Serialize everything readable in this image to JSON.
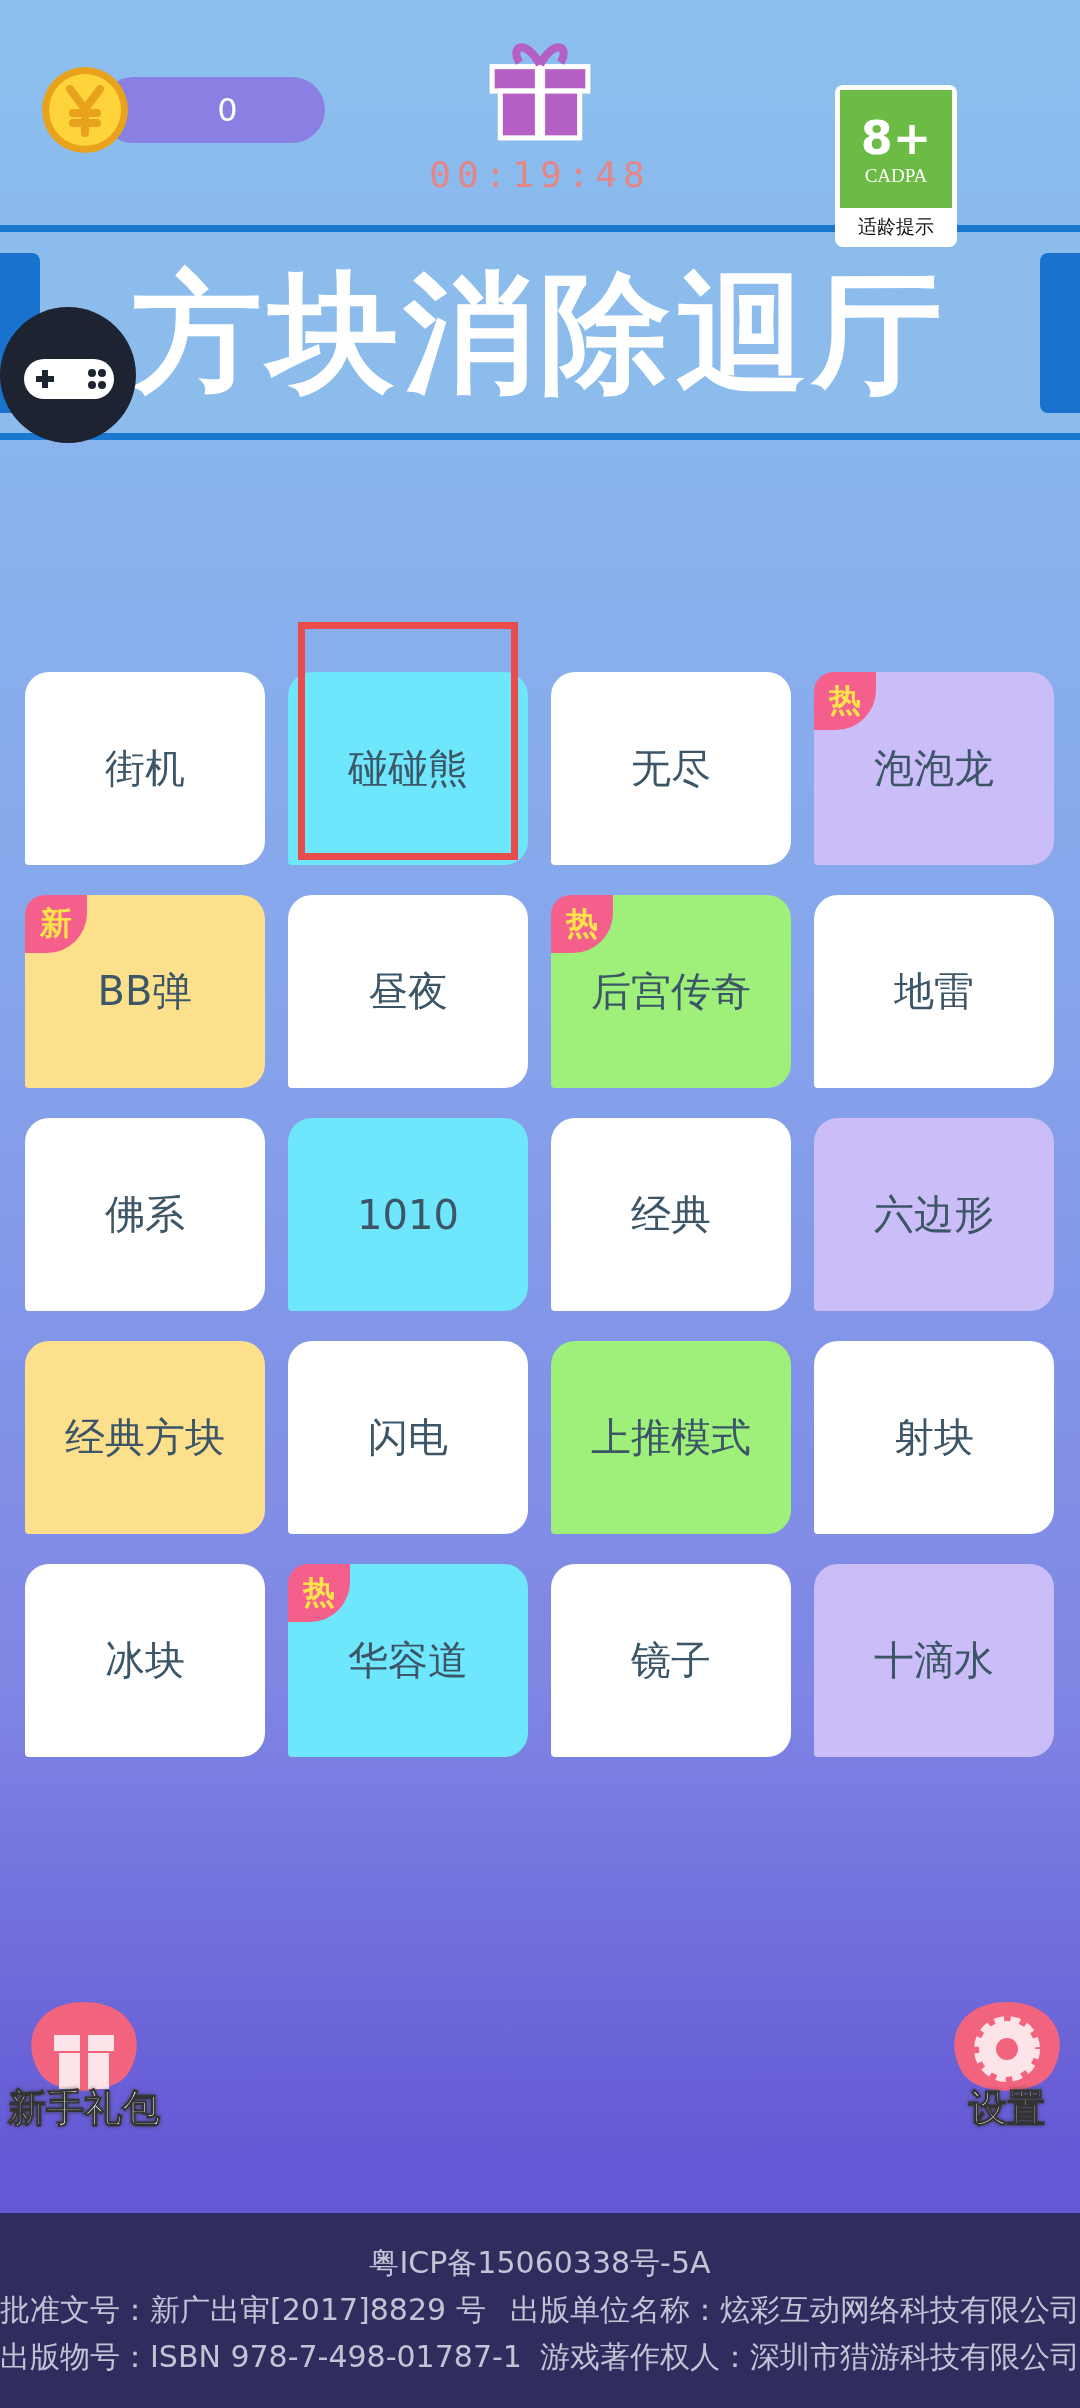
{
  "top_bar": {
    "coins": "0",
    "timer": "00:19:48"
  },
  "rating": {
    "age": "8+",
    "org": "CADPA",
    "note": "适龄提示"
  },
  "title": "方块消除迴厅",
  "modes": [
    {
      "label": "街机",
      "color": "#ffffff",
      "selected": false
    },
    {
      "label": "碰碰熊",
      "color": "#6ee6fb",
      "selected": true
    },
    {
      "label": "无尽",
      "color": "#ffffff",
      "selected": false
    },
    {
      "label": "泡泡龙",
      "color": "#cbbdf8",
      "selected": false,
      "badge": "热"
    },
    {
      "label": "BB弹",
      "color": "#fde08c",
      "selected": false,
      "badge": "新"
    },
    {
      "label": "昼夜",
      "color": "#ffffff",
      "selected": false
    },
    {
      "label": "后宫传奇",
      "color": "#9ef07a",
      "selected": false,
      "badge": "热"
    },
    {
      "label": "地雷",
      "color": "#ffffff",
      "selected": false
    },
    {
      "label": "佛系",
      "color": "#ffffff",
      "selected": false
    },
    {
      "label": "1010",
      "color": "#6ee6fb",
      "selected": false
    },
    {
      "label": "经典",
      "color": "#ffffff",
      "selected": false
    },
    {
      "label": "六边形",
      "color": "#cbbdf8",
      "selected": false
    },
    {
      "label": "经典方块",
      "color": "#fde08c",
      "selected": false
    },
    {
      "label": "闪电",
      "color": "#ffffff",
      "selected": false
    },
    {
      "label": "上推模式",
      "color": "#9ef07a",
      "selected": false
    },
    {
      "label": "射块",
      "color": "#ffffff",
      "selected": false
    },
    {
      "label": "冰块",
      "color": "#ffffff",
      "selected": false
    },
    {
      "label": "华容道",
      "color": "#6ee6fb",
      "selected": false,
      "badge": "热"
    },
    {
      "label": "镜子",
      "color": "#ffffff",
      "selected": false
    },
    {
      "label": "十滴水",
      "color": "#cbbdf8",
      "selected": false
    }
  ],
  "bottom_buttons": [
    {
      "label": "新手礼包",
      "kind": "gift"
    },
    {
      "label": "设置",
      "kind": "settings"
    }
  ],
  "footer": {
    "icp": "粤ICP备15060338号-5A",
    "lines": [
      [
        "批准文号：新广出审[2017]8829 号",
        "出版单位名称：炫彩互动网络科技有限公司"
      ],
      [
        "出版物号：ISBN 978-7-498-01787-1",
        "游戏著作权人：深圳市猎游科技有限公司"
      ]
    ]
  }
}
